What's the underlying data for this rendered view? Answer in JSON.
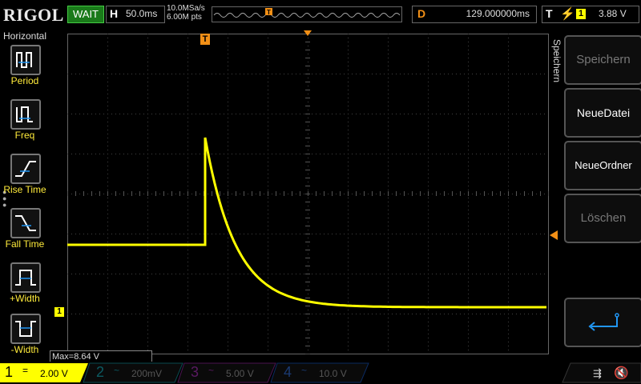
{
  "brand": "RIGOL",
  "status": "WAIT",
  "timebase": {
    "label": "H",
    "value": "50.0ms"
  },
  "acquisition": {
    "sample_rate": "10.0MSa/s",
    "memory_depth": "6.00M pts"
  },
  "delay": {
    "label": "D",
    "value": "129.000000ms"
  },
  "trigger": {
    "label": "T",
    "edge_icon": "rising-edge-icon",
    "source": "1",
    "level": "3.88 V"
  },
  "left_menu": {
    "title": "Horizontal",
    "items": [
      {
        "label": "Period",
        "icon": "period-icon"
      },
      {
        "label": "Freq",
        "icon": "frequency-icon"
      },
      {
        "label": "Rise Time",
        "icon": "rise-time-icon"
      },
      {
        "label": "Fall Time",
        "icon": "fall-time-icon"
      },
      {
        "label": "+Width",
        "icon": "positive-width-icon"
      },
      {
        "label": "-Width",
        "icon": "negative-width-icon"
      }
    ]
  },
  "measurement": {
    "text": "Max=8.64 V"
  },
  "trigger_marker": "T",
  "channel1_marker": "1",
  "right_menu": {
    "title": "Speichern",
    "buttons": [
      {
        "label": "Speichern",
        "enabled": false
      },
      {
        "label": "NeueDatei",
        "enabled": true
      },
      {
        "label": "NeueOrdner",
        "enabled": true
      },
      {
        "label": "Löschen",
        "enabled": false
      }
    ],
    "back_icon": "return-arrow-icon"
  },
  "channels": [
    {
      "num": "1",
      "coupling": "=",
      "scale": "2.00 V",
      "color": "#ffff00",
      "active": true
    },
    {
      "num": "2",
      "coupling": "~",
      "scale": "200mV",
      "color": "#00bcd4",
      "active": false
    },
    {
      "num": "3",
      "coupling": "~",
      "scale": "5.00 V",
      "color": "#e040fb",
      "active": false
    },
    {
      "num": "4",
      "coupling": "~",
      "scale": "10.0 V",
      "color": "#2196f3",
      "active": false
    }
  ],
  "colors": {
    "trace": "#ffff00",
    "trigger": "#f39016",
    "grid": "#555555",
    "status_bg": "#1a7a1a"
  },
  "icons": {
    "usb": "usb-icon",
    "speaker": "speaker-muted-icon"
  }
}
